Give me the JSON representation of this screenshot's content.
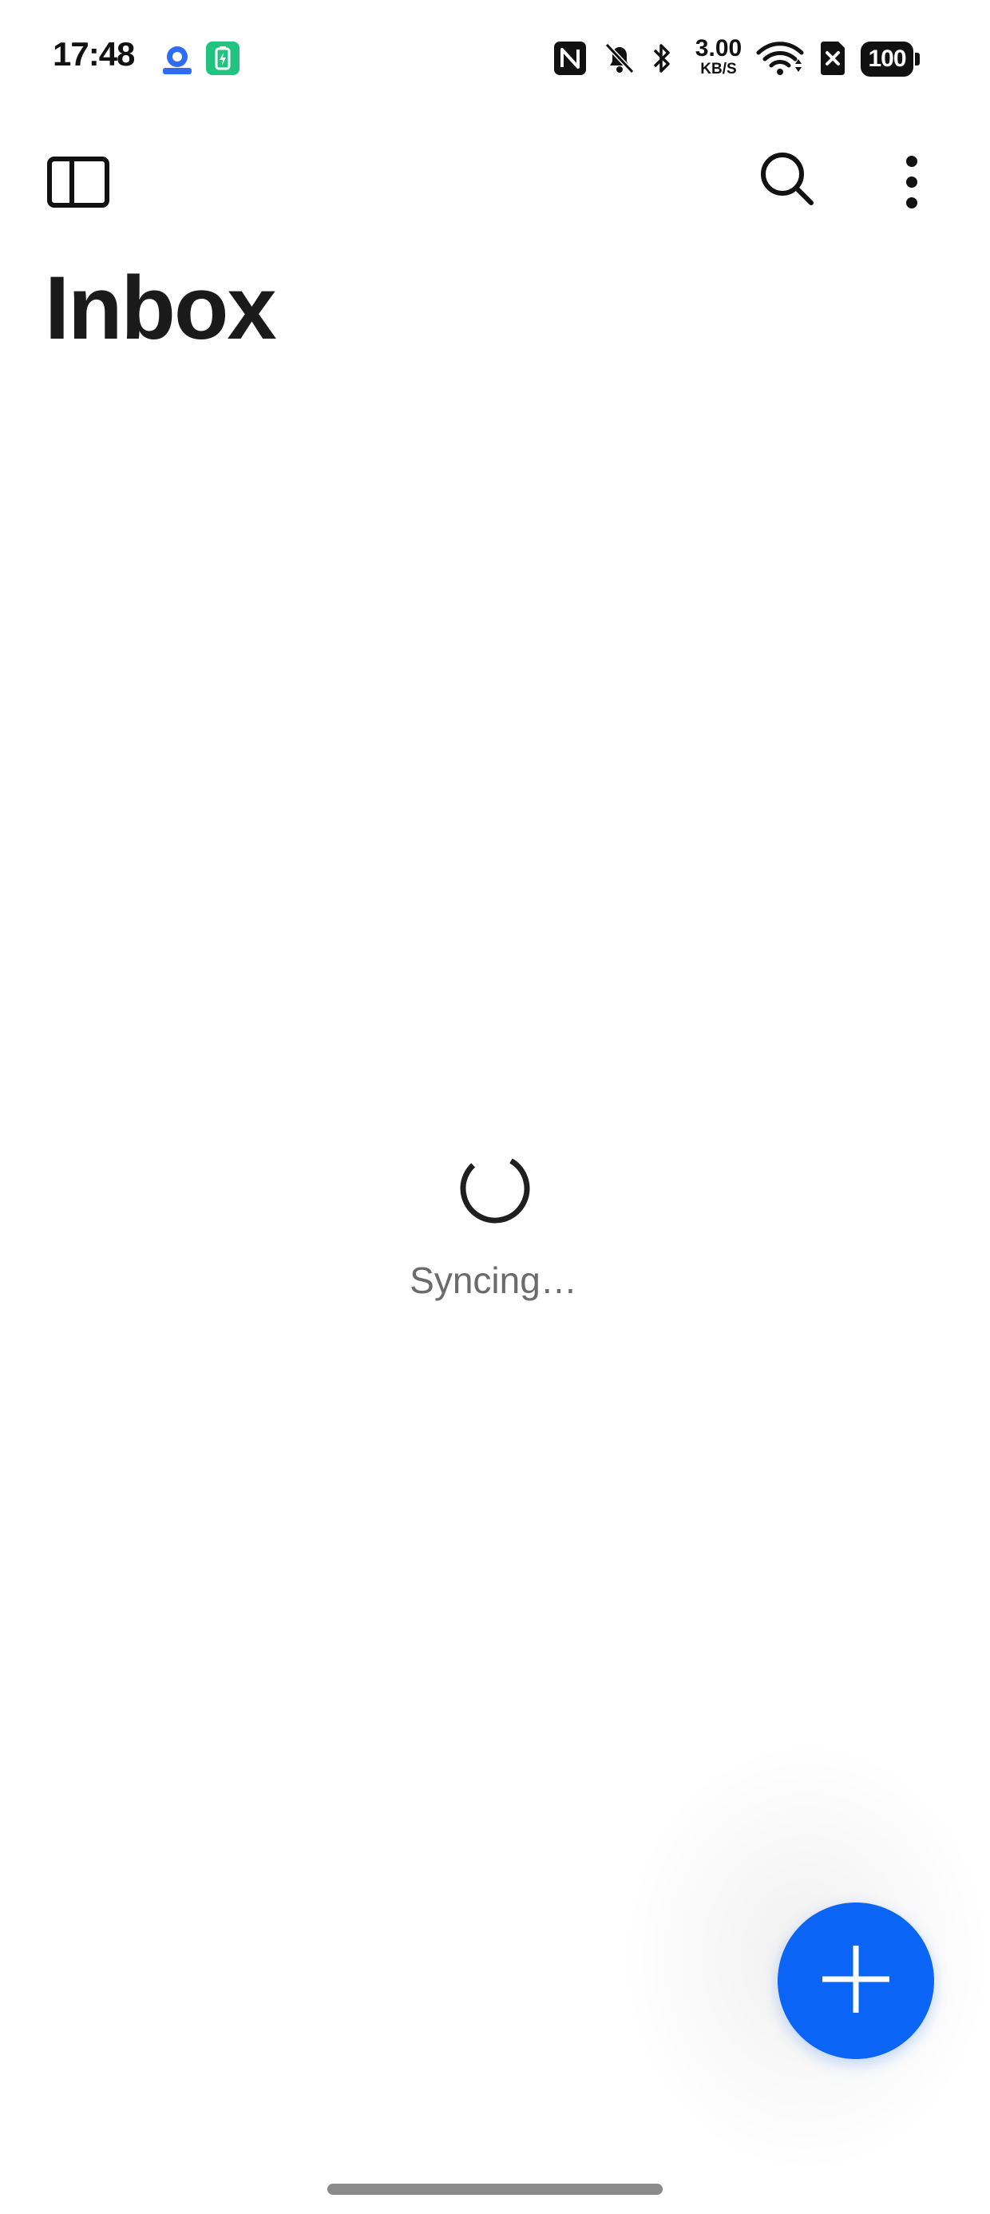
{
  "status_bar": {
    "time": "17:48",
    "net_speed_value": "3.00",
    "net_speed_unit": "KB/S",
    "battery": "100",
    "icons": [
      "app-notification-icon",
      "battery-saver-icon",
      "nfc-icon",
      "do-not-disturb-icon",
      "bluetooth-icon",
      "wifi-icon",
      "sim-disabled-icon"
    ]
  },
  "toolbar": {
    "sidebar_icon": "sidebar-panel-icon",
    "search_icon": "search-icon",
    "more_icon": "more-vertical-icon"
  },
  "page": {
    "title": "Inbox"
  },
  "sync": {
    "status_text": "Syncing…"
  },
  "fab": {
    "icon": "plus-icon"
  },
  "colors": {
    "accent": "#0a64f5",
    "title": "#1a1a1a",
    "secondary_text": "#6b6b6b",
    "background": "#ffffff"
  }
}
